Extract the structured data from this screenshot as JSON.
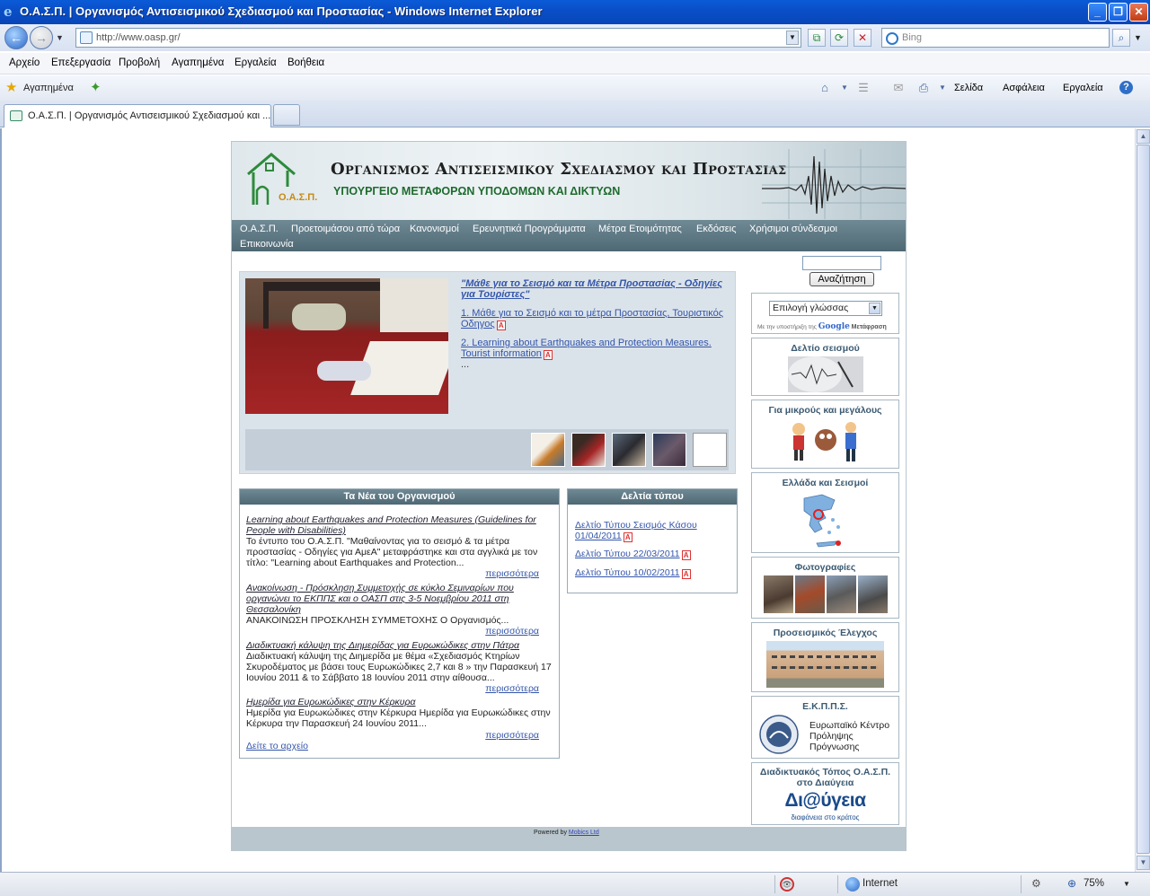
{
  "window": {
    "title": "Ο.Α.Σ.Π. | Οργανισμός Αντισεισμικού Σχεδιασμού και Προστασίας - Windows Internet Explorer"
  },
  "address_bar": {
    "url": "http://www.oasp.gr/",
    "search_placeholder": "Bing"
  },
  "menu": [
    "Αρχείο",
    "Επεξεργασία",
    "Προβολή",
    "Αγαπημένα",
    "Εργαλεία",
    "Βοήθεια"
  ],
  "favorites_bar": {
    "favorites_label": "Αγαπημένα",
    "commands": [
      "Σελίδα",
      "Ασφάλεια",
      "Εργαλεία"
    ]
  },
  "tab": {
    "title": "Ο.Α.Σ.Π. | Οργανισμός Αντισεισμικού Σχεδιασμού και ..."
  },
  "site": {
    "org_title": "Οργανισμος Αντισεισμικου Σχεδιασμου και Προστασιας",
    "ministry": "ΥΠΟΥΡΓΕΙΟ ΜΕΤΑΦΟΡΩΝ ΥΠΟΔΟΜΩΝ ΚΑΙ ΔΙΚΤΥΩΝ",
    "logo_text": "Ο.Α.Σ.Π.",
    "nav": [
      "Ο.Α.Σ.Π.",
      "Προετοιμάσου από τώρα",
      "Κανονισμοί",
      "Ερευνητικά Προγράμματα",
      "Μέτρα Ετοιμότητας",
      "Εκδόσεις",
      "Χρήσιμοι σύνδεσμοι",
      "Επικοινωνία"
    ],
    "feature": {
      "main_link": "\"Μάθε για το Σεισμό και τα Μέτρα Προστασίας - Οδηγίες για Τουρίστες\"",
      "link1": "1. Μάθε για το Σεισμό και το μέτρα Προστασίας, Τουριστικός Οδηγος",
      "link2": "2. Learning about Earthquakes and Protection Measures. Tourist information",
      "ellipsis": "..."
    },
    "news": {
      "header": "Τα Νέα του Οργανισμού",
      "items": [
        {
          "title": "Learning about Earthquakes and Protection Measures (Guidelines for People with Disabilities)",
          "text": "Το έντυπο του Ο.Α.Σ.Π. \"Μαθαίνοντας για το σεισμό & τα μέτρα προστασίας - Οδηγίες για ΑμεΑ\" μεταφράστηκε και στα αγγλικά με τον τίτλο: \"Learning about Earthquakes and Protection...",
          "more": "περισσότερα"
        },
        {
          "title": "Ανακοίνωση - Πρόσκληση Συμμετοχής σε κύκλο Σεμιναρίων που οργανώνει το ΕΚΠΠΣ και ο ΟΑΣΠ στις 3-5 Νοεμβρίου 2011 στη Θεσσαλονίκη",
          "text": "ΑΝΑΚΟΙΝΩΣΗ ΠΡΟΣΚΛΗΣΗ ΣΥΜΜΕΤΟΧΗΣ   Ο Οργανισμός...",
          "more": "περισσότερα"
        },
        {
          "title": "Διαδικτυακή κάλυψη της Διημερίδας για Ευρωκώδικες στην Πάτρα",
          "text": "Διαδικτυακή κάλυψη της Διημερίδα με θέμα «Σχεδιασμός Κτηρίων Σκυροδέματος με βάσει τους Ευρωκώδικες 2,7 και 8 » την Παρασκευή 17 Ιουνίου 2011 & το Σάββατο 18 Ιουνίου 2011 στην αίθουσα...",
          "more": "περισσότερα"
        },
        {
          "title": "Ημερίδα για Ευρωκώδικες στην Κέρκυρα",
          "text": "Ημερίδα για Ευρωκώδικες στην Κέρκυρα   Ημερίδα για Ευρωκώδικες στην Κέρκυρα την Παρασκευή 24 Ιουνίου 2011...",
          "more": "περισσότερα"
        }
      ],
      "archive": "Δείτε το αρχείο"
    },
    "press": {
      "header": "Δελτία τύπου",
      "items": [
        "Δελτίο Τύπου Σεισμός Κάσου 01/04/2011",
        "Δελτίο Τύπου 22/03/2011",
        "Δελτίο Τύπου 10/02/2011"
      ]
    },
    "sidebar": {
      "search_button": "Αναζήτηση",
      "language_select": "Επιλογή γλώσσας",
      "translate_credit": "Με την υποστήριξη της",
      "translate_google": "Google",
      "translate_word": "Μετάφραση",
      "boxes": {
        "bulletin": "Δελτίο σεισμού",
        "kids": "Για μικρούς και μεγάλους",
        "greece": "Ελλάδα και Σεισμοί",
        "photos": "Φωτογραφίες",
        "precheck": "Προσεισμικός Έλεγχος",
        "ekpps_title": "Ε.Κ.Π.Π.Σ.",
        "ekpps_text": "Ευρωπαϊκό Κέντρο Πρόληψης Πρόγνωσης",
        "diavgeia_title": "Διαδικτυακός Τόπος Ο.Α.Σ.Π. στο Διαύγεια",
        "diavgeia_logo": "Δι@ύγεια",
        "diavgeia_sub": "διαφάνεια στο κράτος"
      }
    },
    "footer": {
      "powered": "Powered by",
      "company": "Mobics Ltd"
    }
  },
  "status_bar": {
    "zone": "Internet",
    "zoom": "75%"
  }
}
